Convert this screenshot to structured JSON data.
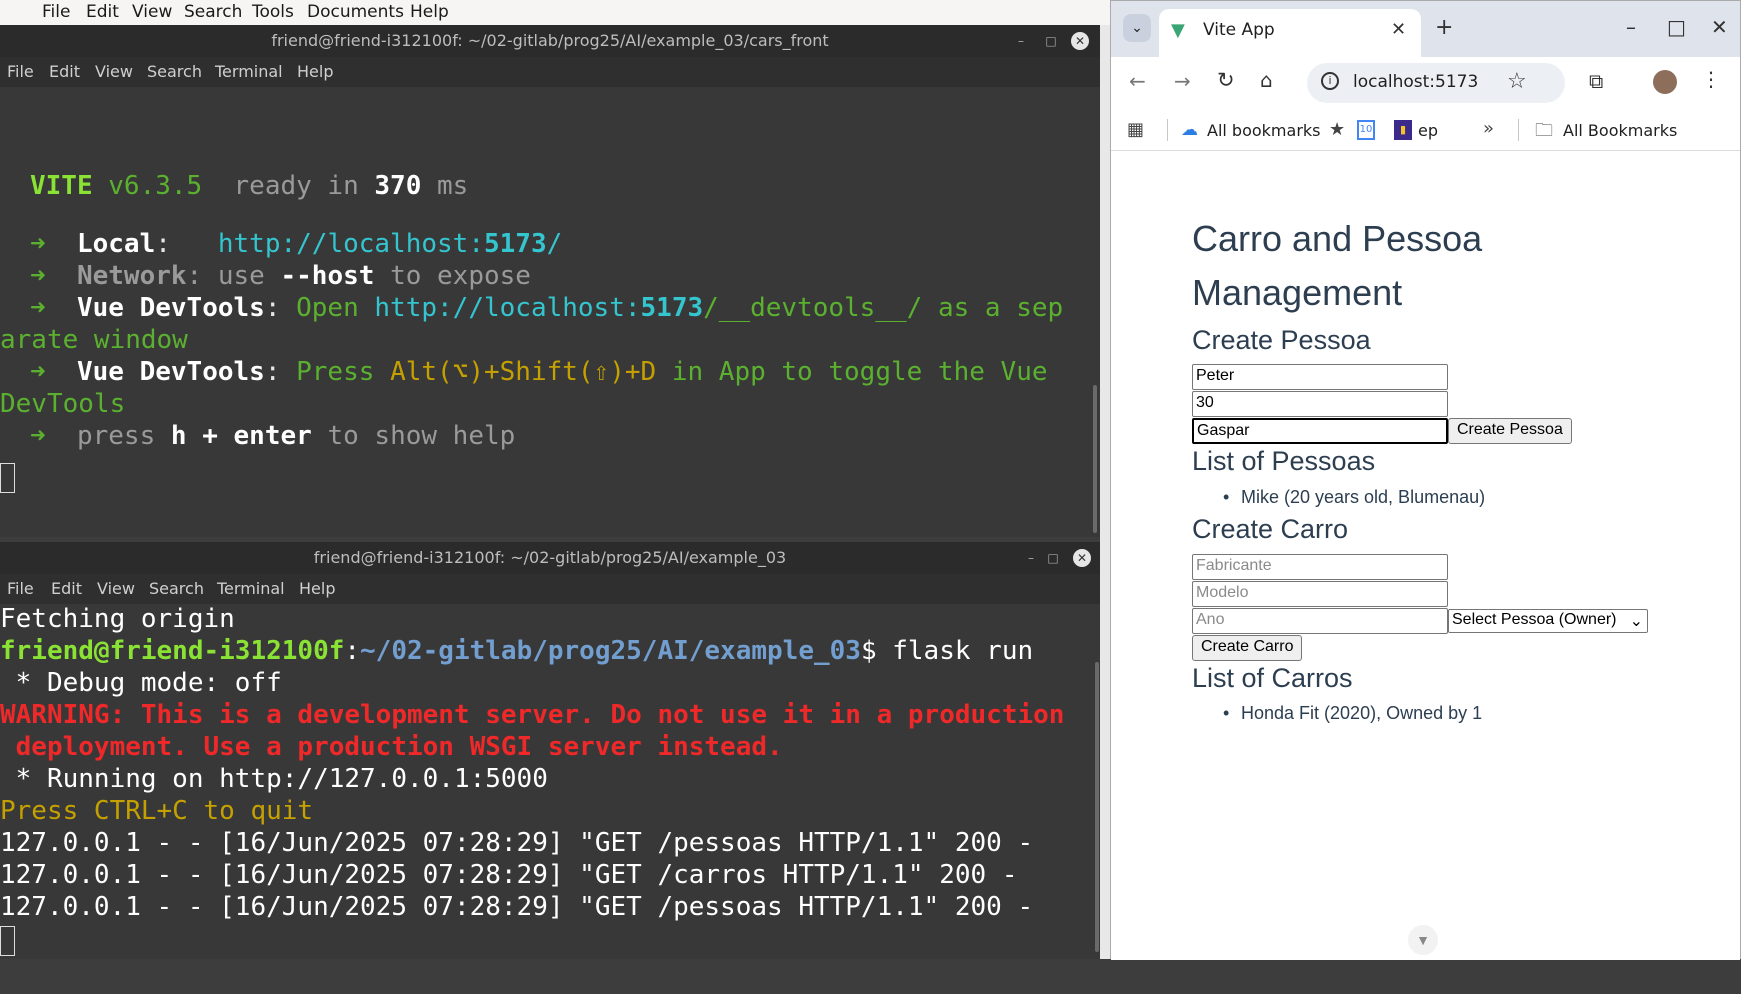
{
  "desktop_menu": {
    "items": [
      "File",
      "Edit",
      "View",
      "Search",
      "Tools",
      "Documents",
      "Help"
    ]
  },
  "terminal_top": {
    "title": "friend@friend-i312100f: ~/02-gitlab/prog25/AI/example_03/cars_front",
    "menu": [
      "File",
      "Edit",
      "View",
      "Search",
      "Terminal",
      "Help"
    ],
    "vite_name": "VITE",
    "vite_version": "v6.3.5",
    "ready_text": "ready in",
    "ready_ms": "370",
    "ms": "ms",
    "arrow": "➜",
    "local_label": "Local",
    "local_url_pre": "http://localhost:",
    "local_port": "5173",
    "local_url_post": "/",
    "network_label": "Network",
    "network_use": "use",
    "network_host": "--host",
    "network_expose": "to expose",
    "devtools_label": "Vue DevTools",
    "devtools1_open": "Open",
    "devtools1_url_pre": "http://localhost:",
    "devtools1_port": "5173",
    "devtools1_url_post": "/__devtools__/",
    "devtools1_rest": "as a sep",
    "devtools1_wrap": "arate window",
    "devtools2_press": "Press",
    "devtools2_keys": "Alt(⌥)+Shift(⇧)+D",
    "devtools2_rest": "in App to toggle the Vue",
    "devtools2_wrap": "DevTools",
    "help_press": "press",
    "help_keys": "h + enter",
    "help_rest": "to show help"
  },
  "terminal_bottom": {
    "title": "friend@friend-i312100f: ~/02-gitlab/prog25/AI/example_03",
    "menu": [
      "File",
      "Edit",
      "View",
      "Search",
      "Terminal",
      "Help"
    ],
    "line_fetch": "Fetching origin",
    "prompt_user": "friend@friend-i312100f",
    "prompt_colon": ":",
    "prompt_path": "~/02-gitlab/prog25/AI/example_03",
    "prompt_cmd": "$ flask run",
    "debug": " * Debug mode: off",
    "warning1": "WARNING: This is a development server. Do not use it in a production",
    "warning2": " deployment. Use a production WSGI server instead.",
    "running": " * Running on http://127.0.0.1:5000",
    "quit": "Press CTRL+C to quit",
    "log": [
      "127.0.0.1 - - [16/Jun/2025 07:28:29] \"GET /pessoas HTTP/1.1\" 200 -",
      "127.0.0.1 - - [16/Jun/2025 07:28:29] \"GET /carros HTTP/1.1\" 200 -",
      "127.0.0.1 - - [16/Jun/2025 07:28:29] \"GET /pessoas HTTP/1.1\" 200 -"
    ]
  },
  "browser": {
    "tab_title": "Vite App",
    "url": "localhost:5173",
    "bookmarks": {
      "all_bookmarks": "All bookmarks",
      "ep": "ep",
      "calendar_day": "10",
      "all_bookmarks_folder": "All Bookmarks"
    },
    "page": {
      "title_line1": "Carro and Pessoa",
      "title_line2": "Management",
      "create_pessoa_heading": "Create Pessoa",
      "pessoa_nome": "Peter",
      "pessoa_idade": "30",
      "pessoa_cidade": "Gaspar",
      "create_pessoa_button": "Create Pessoa",
      "list_pessoas_heading": "List of Pessoas",
      "pessoas": [
        "Mike (20 years old, Blumenau)"
      ],
      "create_carro_heading": "Create Carro",
      "fabricante_placeholder": "Fabricante",
      "modelo_placeholder": "Modelo",
      "ano_placeholder": "Ano",
      "owner_select": "Select Pessoa (Owner)",
      "create_carro_button": "Create Carro",
      "list_carros_heading": "List of Carros",
      "carros": [
        "Honda Fit (2020), Owned by 1"
      ]
    }
  }
}
